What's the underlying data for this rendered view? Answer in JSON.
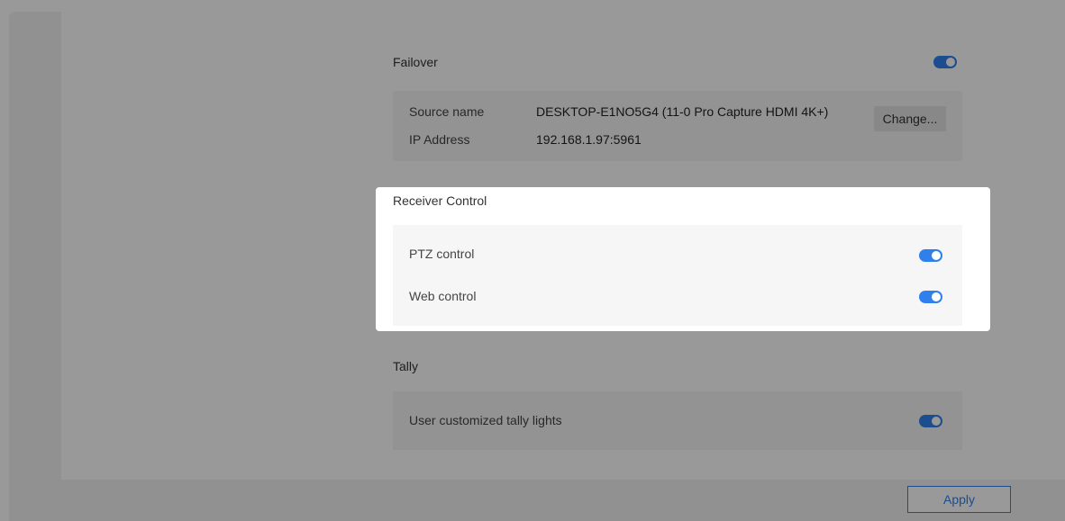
{
  "failover": {
    "title": "Failover",
    "enabled": true,
    "source_name_label": "Source name",
    "source_name_value": "DESKTOP-E1NO5G4 (11-0 Pro Capture HDMI 4K+)",
    "ip_label": "IP Address",
    "ip_value": "192.168.1.97:5961",
    "change_label": "Change..."
  },
  "receiver_control": {
    "title": "Receiver Control",
    "ptz_label": "PTZ control",
    "ptz_enabled": true,
    "web_label": "Web control",
    "web_enabled": true
  },
  "tally": {
    "title": "Tally",
    "custom_label": "User customized tally lights",
    "custom_enabled": true
  },
  "apply_label": "Apply",
  "colors": {
    "accent": "#2f80ed",
    "overlay": "rgba(0,0,0,0.4)"
  }
}
